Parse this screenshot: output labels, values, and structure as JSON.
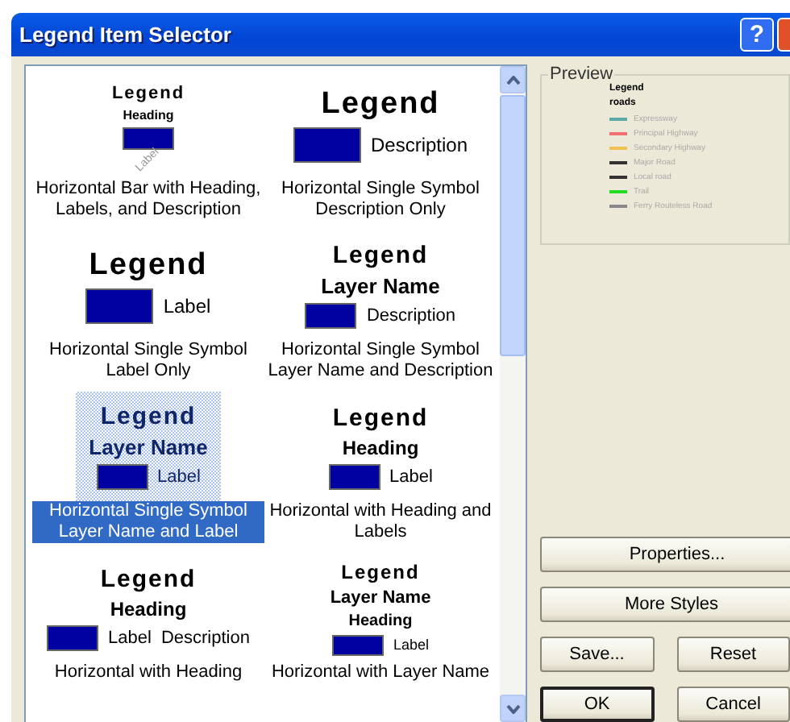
{
  "window": {
    "title": "Legend Item Selector",
    "help_button": "?"
  },
  "styles": [
    {
      "kind": "bar",
      "legend": "Legend",
      "heading": "Heading",
      "labels": [
        "Label"
      ],
      "caption": "Horizontal Bar with Heading, Labels, and Description",
      "selected": false
    },
    {
      "kind": "large",
      "legend": "Legend",
      "labels": [
        "Description"
      ],
      "caption": "Horizontal Single Symbol Description Only",
      "selected": false
    },
    {
      "kind": "large",
      "legend": "Legend",
      "labels": [
        "Label"
      ],
      "caption": "Horizontal Single Symbol Label Only",
      "selected": false
    },
    {
      "kind": "medium",
      "legend": "Legend",
      "layer_name": "Layer Name",
      "labels": [
        "Description"
      ],
      "caption": "Horizontal Single Symbol Layer Name and Description",
      "selected": false
    },
    {
      "kind": "medium",
      "legend": "Legend",
      "layer_name": "Layer Name",
      "labels": [
        "Label"
      ],
      "caption": "Horizontal Single Symbol Layer Name and Label",
      "selected": true
    },
    {
      "kind": "medium",
      "legend": "Legend",
      "heading": "Heading",
      "labels": [
        "Label"
      ],
      "caption": "Horizontal with Heading and Labels",
      "selected": false
    },
    {
      "kind": "medium",
      "legend": "Legend",
      "heading": "Heading",
      "labels": [
        "Label",
        "Description"
      ],
      "caption": "Horizontal with Heading",
      "selected": false
    },
    {
      "kind": "small",
      "legend": "Legend",
      "layer_name": "Layer Name",
      "heading": "Heading",
      "labels": [
        "Label"
      ],
      "caption": "Horizontal with Layer Name",
      "selected": false
    }
  ],
  "preview": {
    "title": "Preview",
    "legend": "Legend",
    "layer_name": "roads",
    "items": [
      {
        "label": "Expressway",
        "color": "#5fa8a8"
      },
      {
        "label": "Principal Highway",
        "color": "#f07070"
      },
      {
        "label": "Secondary Highway",
        "color": "#f0c050"
      },
      {
        "label": "Major Road",
        "color": "#333333"
      },
      {
        "label": "Local road",
        "color": "#333333"
      },
      {
        "label": "Trail",
        "color": "#22dd22"
      },
      {
        "label": "Ferry Routeless Road",
        "color": "#888888"
      }
    ]
  },
  "buttons": {
    "properties": "Properties...",
    "more_styles": "More Styles",
    "save": "Save...",
    "reset": "Reset",
    "ok": "OK",
    "cancel": "Cancel"
  }
}
